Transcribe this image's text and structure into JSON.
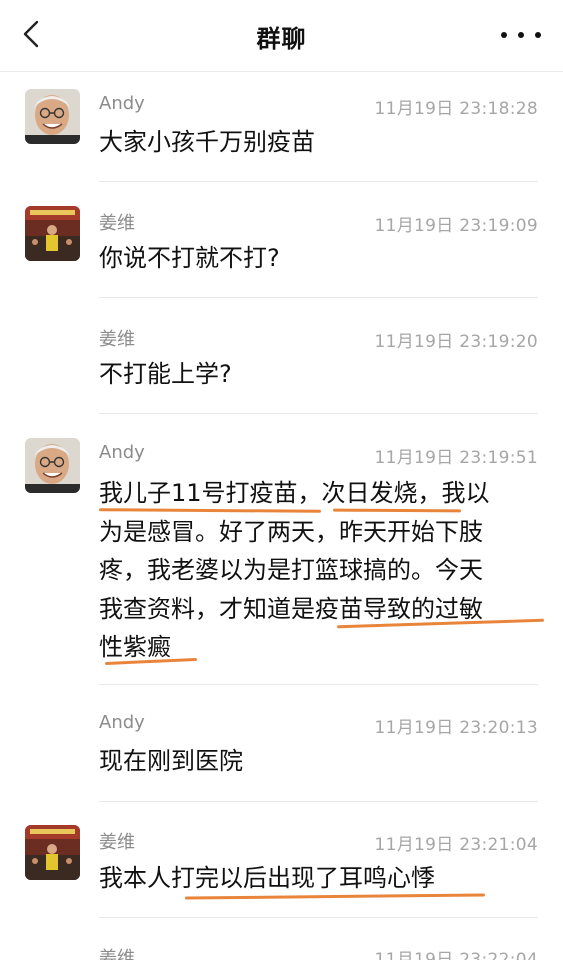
{
  "header": {
    "title": "群聊",
    "back_icon": "chevron-left-icon",
    "more_icon": "more-horizontal-icon"
  },
  "messages": [
    {
      "sender": "Andy",
      "time": "11月19日 23:18:28",
      "text": "大家小孩千万别疫苗",
      "avatar": "elderly-man-avatar"
    },
    {
      "sender": "姜维",
      "time": "11月19日 23:19:09",
      "text": "你说不打就不打?",
      "avatar": "event-photo-avatar"
    },
    {
      "sender": "姜维",
      "time": "11月19日 23:19:20",
      "text": "不打能上学?"
    },
    {
      "sender": "Andy",
      "time": "11月19日 23:19:51",
      "avatar": "elderly-man-avatar",
      "lines": [
        "我儿子11号打疫苗，次日发烧，我以",
        "为是感冒。好了两天，昨天开始下肢",
        "疼，我老婆以为是打篮球搞的。今天",
        "我查资料，才知道是疫苗导致的过敏",
        "性紫癜"
      ]
    },
    {
      "sender": "Andy",
      "time": "11月19日 23:20:13",
      "text": "现在刚到医院"
    },
    {
      "sender": "姜维",
      "time": "11月19日 23:21:04",
      "text": "我本人打完以后出现了耳鸣心悸",
      "avatar": "event-photo-avatar"
    },
    {
      "sender": "姜维",
      "time": "11月19日 23:22:04"
    }
  ],
  "colors": {
    "underline": "#e8853a",
    "time": "#a6a6a6",
    "sender": "#8c8c8c"
  }
}
